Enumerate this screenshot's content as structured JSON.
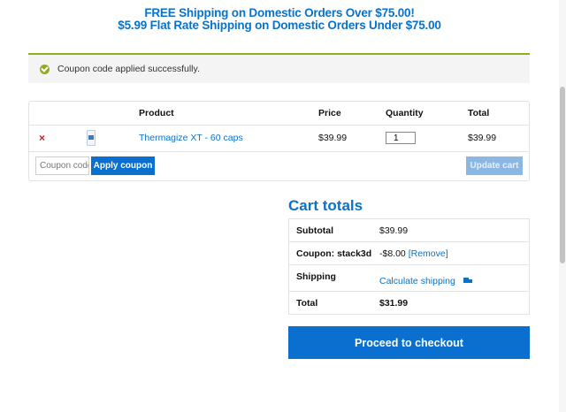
{
  "banner": {
    "line1": "FREE Shipping on Domestic Orders Over $75.00!",
    "line2": "$5.99 Flat Rate Shipping on Domestic Orders Under $75.00"
  },
  "notice": {
    "icon": "check-circle-icon",
    "message": "Coupon code applied successfully."
  },
  "cart": {
    "headers": {
      "product": "Product",
      "price": "Price",
      "quantity": "Quantity",
      "total": "Total"
    },
    "items": [
      {
        "remove_symbol": "×",
        "thumbnail_icon": "product-thumbnail-icon",
        "name": "Thermagize XT - 60 caps",
        "price": "$39.99",
        "quantity": "1",
        "total": "$39.99"
      }
    ],
    "coupon_placeholder": "Coupon code",
    "apply_label": "Apply coupon",
    "update_label": "Update cart"
  },
  "totals": {
    "title": "Cart totals",
    "subtotal_label": "Subtotal",
    "subtotal_value": "$39.99",
    "coupon_label": "Coupon: stack3d",
    "coupon_value": "-$8.00",
    "coupon_remove": "[Remove]",
    "shipping_label": "Shipping",
    "shipping_link": "Calculate shipping",
    "shipping_icon": "truck-icon",
    "total_label": "Total",
    "total_value": "$31.99"
  },
  "checkout_label": "Proceed to checkout",
  "colors": {
    "accent": "#0a72c8",
    "button": "#0a6fce",
    "success": "#8fae1b",
    "remove": "#d01b1b"
  }
}
